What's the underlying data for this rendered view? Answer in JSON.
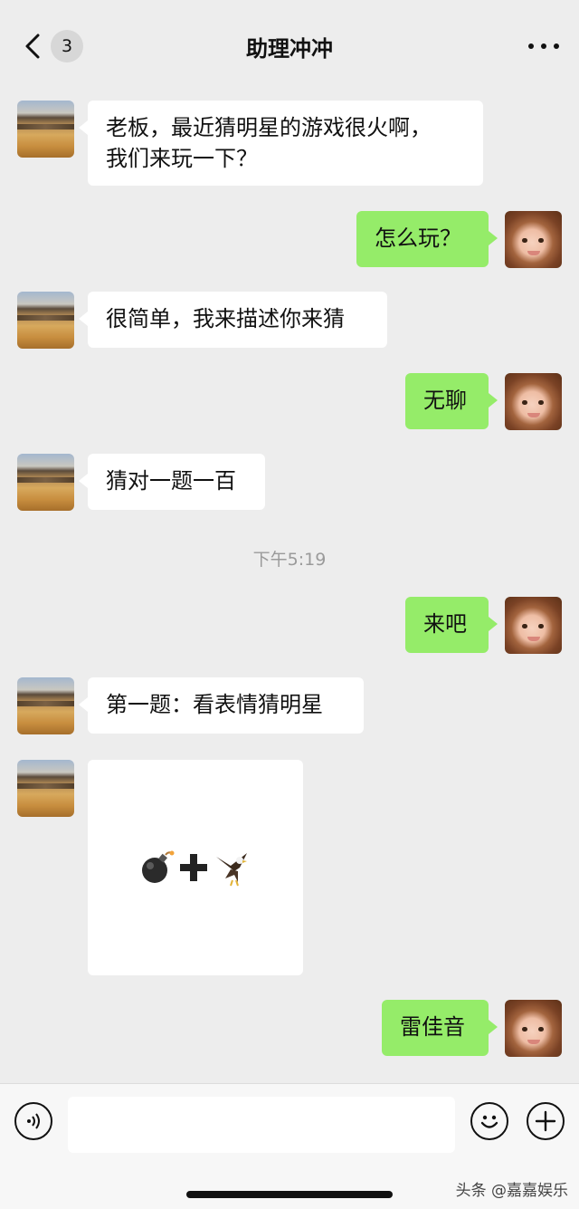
{
  "header": {
    "back_badge": "3",
    "title": "助理冲冲"
  },
  "messages": [
    {
      "side": "left",
      "text_line1": "老板，最近猜明星的游戏很火啊，",
      "text_line2": "我们来玩一下？"
    },
    {
      "side": "right",
      "text": "怎么玩？"
    },
    {
      "side": "left",
      "text": "很简单，我来描述你来猜"
    },
    {
      "side": "right",
      "text": "无聊"
    },
    {
      "side": "left",
      "text": "猜对一题一百"
    },
    {
      "side": "right",
      "text": "来吧"
    },
    {
      "side": "left",
      "text": "第一题：看表情猜明星"
    },
    {
      "side": "left",
      "type": "image",
      "emoji": [
        "bomb",
        "plus",
        "eagle"
      ]
    },
    {
      "side": "right",
      "text": "雷佳音"
    }
  ],
  "timestamp": "下午5:19",
  "input_bar": {
    "voice_icon": "voice-icon",
    "emoji_icon": "emoji-icon",
    "plus_icon": "plus-icon"
  },
  "watermark": "头条 @嘉嘉娱乐",
  "colors": {
    "background": "#ededed",
    "sent_bubble": "#95ec69",
    "received_bubble": "#ffffff"
  }
}
